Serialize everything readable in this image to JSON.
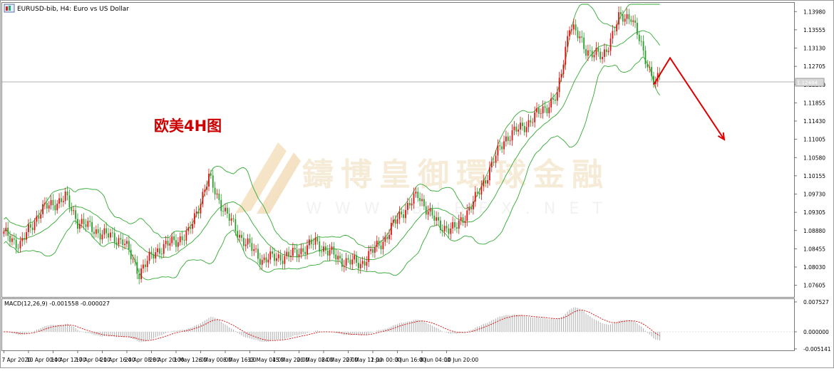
{
  "header": {
    "symbol_title": "EURUSD-bib, H4:  Euro vs US Dollar"
  },
  "annotation": {
    "text": "欧美4H图",
    "color": "#cc0000"
  },
  "watermark": {
    "cn": "鑄博皇御環球金融",
    "en": "W W W . B I B F X . N E T"
  },
  "colors": {
    "bull": "#e01010",
    "bear": "#2a9d2a",
    "bands": "#33aa33",
    "macd_hist": "#b4b4b4",
    "macd_signal": "#dd0000",
    "arrow": "#e00000"
  },
  "macd": {
    "label": "MACD(12,26,9) -0.001558 -0.000027",
    "axis_ticks": [
      "0.007527",
      "0.000000",
      "-0.005141"
    ]
  },
  "price_axis": {
    "ticks": [
      "1.13980",
      "1.13555",
      "1.13130",
      "1.12705",
      "1.12280",
      "1.11855",
      "1.11430",
      "1.11005",
      "1.10580",
      "1.10155",
      "1.09730",
      "1.09305",
      "1.08880",
      "1.08455",
      "1.08030",
      "1.07605"
    ],
    "current_price": "1.12484"
  },
  "time_axis": {
    "labels": [
      "7 Apr 2020",
      "10 Apr 00:00",
      "14 Apr 12:00",
      "17 Apr 04:00",
      "21 Apr 16:00",
      "24 Apr 08:00",
      "28 Apr 20:00",
      "1 May 12:00",
      "6 May 00:00",
      "8 May 16:00",
      "13 May 04:00",
      "15 May 20:00",
      "20 May 08:00",
      "24 May 20:00",
      "27 May 12:00",
      "1 Jun 00:00",
      "3 Jun 16:00",
      "8 Jun 04:00",
      "10 Jun 20:00"
    ]
  },
  "chart_data": {
    "type": "candlestick",
    "symbol": "EURUSD-bib",
    "timeframe": "H4",
    "y_range": [
      1.0735,
      1.1415
    ],
    "current_price": 1.12484,
    "indicators": [
      "Bollinger Bands",
      "MACD(12,26,9)"
    ],
    "macd_values": {
      "main": -0.001558,
      "signal": -2.7e-05
    },
    "candles_per_label": 12,
    "close_anchors": [
      [
        0,
        1.088
      ],
      [
        8,
        1.0855
      ],
      [
        18,
        1.0935
      ],
      [
        30,
        1.0965
      ],
      [
        36,
        1.091
      ],
      [
        48,
        1.088
      ],
      [
        58,
        1.0865
      ],
      [
        66,
        1.079
      ],
      [
        74,
        1.084
      ],
      [
        90,
        1.088
      ],
      [
        100,
        1.101
      ],
      [
        108,
        1.093
      ],
      [
        116,
        1.087
      ],
      [
        126,
        1.082
      ],
      [
        140,
        1.083
      ],
      [
        152,
        1.086
      ],
      [
        164,
        1.082
      ],
      [
        174,
        1.081
      ],
      [
        186,
        1.087
      ],
      [
        194,
        1.093
      ],
      [
        202,
        1.097
      ],
      [
        212,
        1.09
      ],
      [
        220,
        1.089
      ],
      [
        230,
        1.096
      ],
      [
        244,
        1.11
      ],
      [
        256,
        1.114
      ],
      [
        270,
        1.12
      ],
      [
        276,
        1.137
      ],
      [
        284,
        1.131
      ],
      [
        292,
        1.129
      ],
      [
        300,
        1.138
      ],
      [
        306,
        1.139
      ],
      [
        312,
        1.13
      ],
      [
        318,
        1.123
      ],
      [
        320,
        1.1248
      ]
    ],
    "forecast_arrow": {
      "from": 1.1228,
      "peak": 1.129,
      "to": 1.11
    }
  }
}
